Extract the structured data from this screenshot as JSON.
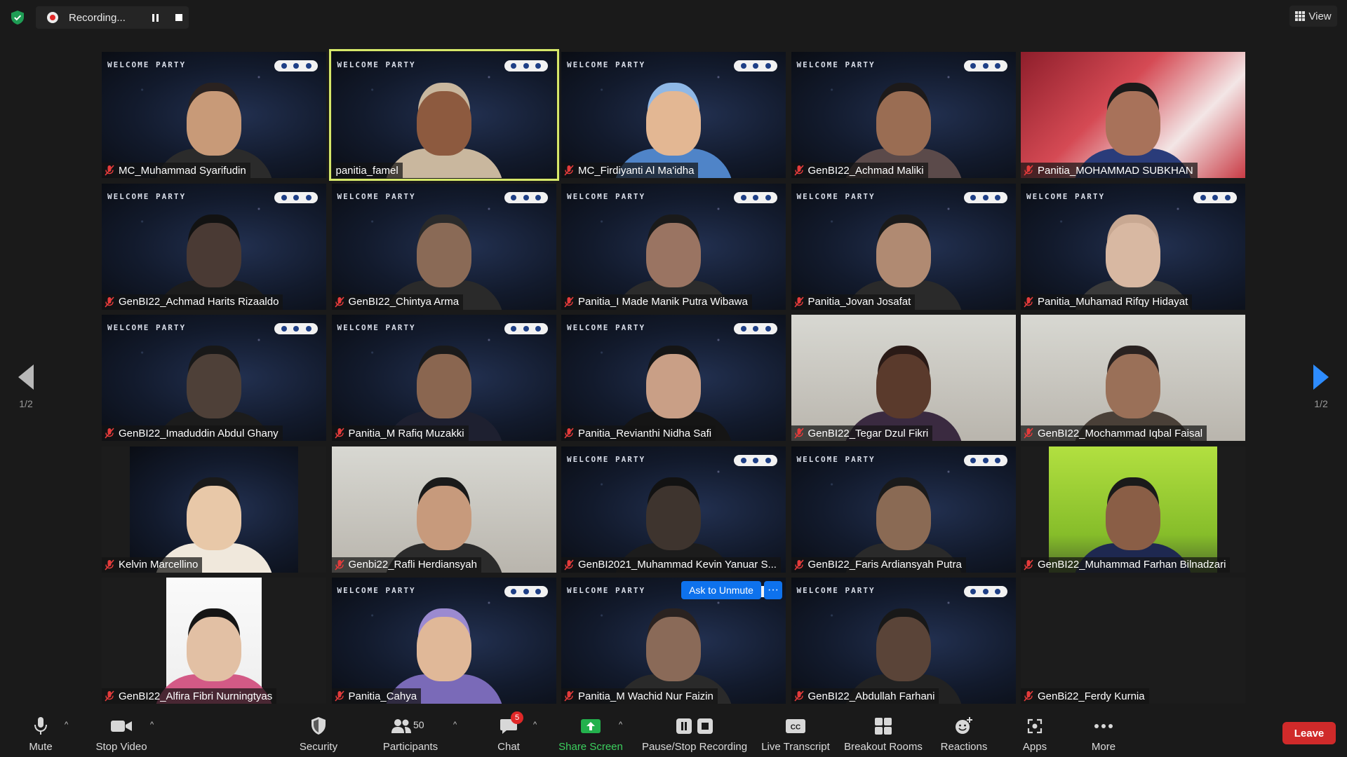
{
  "recording": {
    "label": "Recording..."
  },
  "view": {
    "label": "View"
  },
  "banner_text": "WELCOME PARTY",
  "ask_unmute": {
    "label": "Ask to Unmute",
    "more": "···"
  },
  "pager": {
    "left": "1/2",
    "right": "1/2"
  },
  "participants": [
    {
      "name": "MC_Muhammad Syarifudin",
      "bg": "space",
      "muted": true,
      "skin": "#c89a78",
      "hair": "#2a2220",
      "shirt": "#2b2b2b"
    },
    {
      "name": "panitia_famel",
      "bg": "space",
      "muted": false,
      "active": true,
      "skin": "#8d5a3f",
      "hair": "#c9b79e",
      "shirt": "#c9b79e"
    },
    {
      "name": "MC_Firdiyanti Al Ma'idha",
      "bg": "space",
      "muted": true,
      "skin": "#e3b793",
      "hair": "#8fb8e6",
      "shirt": "#4f84c8"
    },
    {
      "name": "GenBI22_Achmad Maliki",
      "bg": "space",
      "muted": true,
      "skin": "#9a6d53",
      "hair": "#1d1a1a",
      "shirt": "#5b4a4a"
    },
    {
      "name": "Panitia_MOHAMMAD SUBKHAN",
      "bg": "red",
      "muted": true,
      "skin": "#a8725a",
      "hair": "#1a1a1a",
      "shirt": "#2a3c7a"
    },
    {
      "name": "GenBI22_Achmad Harits Rizaaldo",
      "bg": "space",
      "muted": true,
      "skin": "#4a3a34",
      "hair": "#121212",
      "shirt": "#1c1c1c"
    },
    {
      "name": "GenBI22_Chintya Arma",
      "bg": "space",
      "muted": true,
      "skin": "#8a6a56",
      "hair": "#2a2a2a",
      "shirt": "#2a2a2a"
    },
    {
      "name": "Panitia_I Made Manik Putra Wibawa",
      "bg": "space",
      "muted": true,
      "skin": "#9a7462",
      "hair": "#1a1a1a",
      "shirt": "#2b2b2b"
    },
    {
      "name": "Panitia_Jovan Josafat",
      "bg": "space",
      "muted": true,
      "skin": "#b08a72",
      "hair": "#1a1a1a",
      "shirt": "#2a2a2a"
    },
    {
      "name": "Panitia_Muhamad Rifqy Hidayat",
      "bg": "space",
      "muted": true,
      "skin": "#d8b8a2",
      "hair": "#c8a892",
      "shirt": "#3a3a3a"
    },
    {
      "name": "GenBI22_Imaduddin Abdul Ghany",
      "bg": "space",
      "muted": true,
      "skin": "#4e4038",
      "hair": "#181818",
      "shirt": "#1c1c1c"
    },
    {
      "name": "Panitia_M Rafiq Muzakki",
      "bg": "space",
      "muted": true,
      "skin": "#8a6650",
      "hair": "#1a1a1a",
      "shirt": "#1e2030"
    },
    {
      "name": "Panitia_Revianthi Nidha Safi",
      "bg": "space",
      "muted": true,
      "skin": "#c99f86",
      "hair": "#151515",
      "shirt": "#151515"
    },
    {
      "name": "GenBI22_Tegar Dzul Fikri",
      "bg": "plain",
      "muted": true,
      "skin": "#5a3a2c",
      "hair": "#2a1a16",
      "shirt": "#3a2a40"
    },
    {
      "name": "GenBI22_Mochammad Iqbal Faisal",
      "bg": "plain",
      "muted": true,
      "skin": "#9a7058",
      "hair": "#2a2220",
      "shirt": "#4a4038"
    },
    {
      "name": "Kelvin Marcellino",
      "bg": "space",
      "muted": true,
      "portrait": true,
      "skin": "#e8c8a8",
      "hair": "#1a1a1a",
      "shirt": "#f0e8dc"
    },
    {
      "name": "Genbi22_Rafli Herdiansyah",
      "bg": "plain",
      "muted": true,
      "skin": "#c79a7c",
      "hair": "#1a1a1a",
      "shirt": "#2b2b2b"
    },
    {
      "name": "GenBI2021_Muhammad Kevin Yanuar S...",
      "bg": "space",
      "muted": true,
      "skin": "#3e342e",
      "hair": "#121212",
      "shirt": "#1c1c1c"
    },
    {
      "name": "GenBI22_Faris Ardiansyah Putra",
      "bg": "space",
      "muted": true,
      "skin": "#8a6a54",
      "hair": "#1a1a1a",
      "shirt": "#2a2a2a"
    },
    {
      "name": "GenBI22_Muhammad Farhan Bilnadzari",
      "bg": "green",
      "muted": true,
      "portrait": true,
      "skin": "#8a5e46",
      "hair": "#1a1a1a",
      "shirt": "#1e2850"
    },
    {
      "name": "GenBI22_Alfira Fibri Nurningtyas",
      "bg": "space",
      "muted": true,
      "portrait": true,
      "skin": "#e2c0a4",
      "hair": "#151515",
      "shirt": "#d35a86"
    },
    {
      "name": "Panitia_Cahya",
      "bg": "space",
      "muted": true,
      "skin": "#e0b898",
      "hair": "#9b8ad0",
      "shirt": "#7a6ab8"
    },
    {
      "name": "Panitia_M Wachid Nur Faizin",
      "bg": "space",
      "muted": true,
      "skin": "#8a6a58",
      "hair": "#2a2220",
      "shirt": "#2a2a2a"
    },
    {
      "name": "GenBI22_Abdullah Farhani",
      "bg": "space",
      "muted": true,
      "skin": "#5a4438",
      "hair": "#181818",
      "shirt": "#222"
    },
    {
      "name": "GenBi22_Ferdy Kurnia",
      "bg": "empty",
      "muted": true
    }
  ],
  "toolbar": {
    "mute": "Mute",
    "stop_video": "Stop Video",
    "security": "Security",
    "participants": "Participants",
    "participants_count": "50",
    "chat": "Chat",
    "chat_badge": "5",
    "share_screen": "Share Screen",
    "pause_recording": "Pause/Stop Recording",
    "live_transcript": "Live Transcript",
    "cc": "CC",
    "breakout_rooms": "Breakout Rooms",
    "reactions": "Reactions",
    "apps": "Apps",
    "more": "More",
    "leave": "Leave"
  },
  "colors": {
    "accent_blue": "#0e72ed",
    "share_green": "#3ccf5e",
    "leave_red": "#d02a2a",
    "active_speaker": "#d6e86a"
  }
}
